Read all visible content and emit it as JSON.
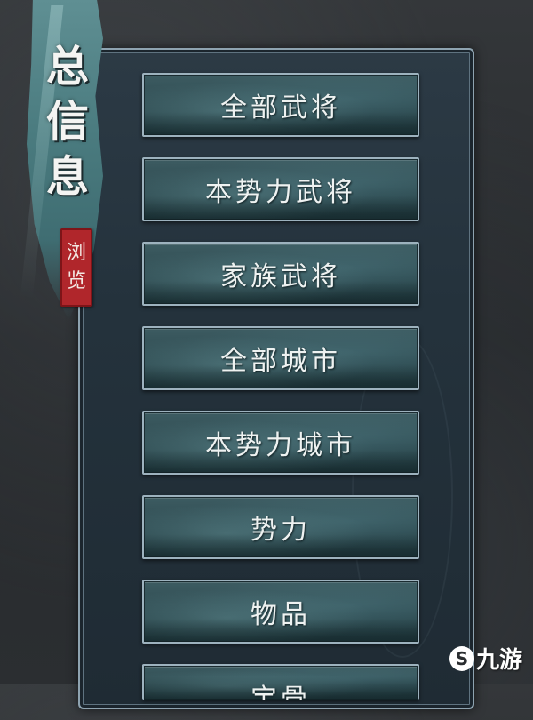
{
  "title": {
    "chars": [
      "总",
      "信",
      "息"
    ]
  },
  "seal": {
    "chars": [
      "浏",
      "览"
    ]
  },
  "menu": {
    "items": [
      {
        "label": "全部武将"
      },
      {
        "label": "本势力武将"
      },
      {
        "label": "家族武将"
      },
      {
        "label": "全部城市"
      },
      {
        "label": "本势力城市"
      },
      {
        "label": "势力"
      },
      {
        "label": "物品"
      },
      {
        "label": "宝骨"
      }
    ]
  },
  "watermark": {
    "icon": "logo-icon",
    "icon_glyph": "S",
    "text": "九游"
  }
}
